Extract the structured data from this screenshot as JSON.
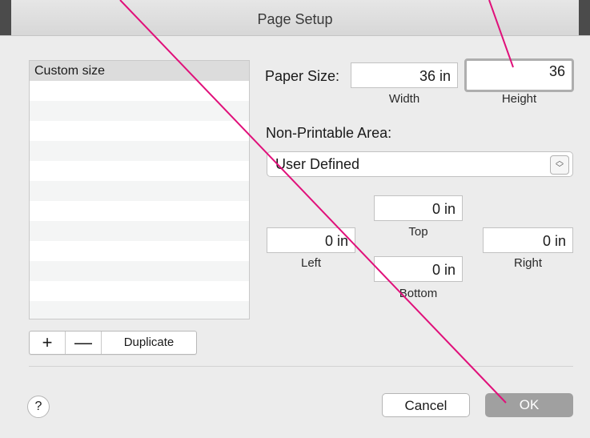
{
  "window": {
    "title": "Page Setup"
  },
  "list": {
    "items": [
      "Custom size"
    ],
    "empty_rows": 12
  },
  "list_buttons": {
    "add": "+",
    "remove": "—",
    "duplicate": "Duplicate"
  },
  "paper_size": {
    "label": "Paper Size:",
    "width_value": "36 in",
    "height_value": "36",
    "width_caption": "Width",
    "height_caption": "Height"
  },
  "non_printable": {
    "label": "Non-Printable Area:",
    "selected": "User Defined",
    "top_value": "0 in",
    "top_label": "Top",
    "left_value": "0 in",
    "left_label": "Left",
    "right_value": "0 in",
    "right_label": "Right",
    "bottom_value": "0 in",
    "bottom_label": "Bottom"
  },
  "footer": {
    "help": "?",
    "cancel": "Cancel",
    "ok": "OK"
  },
  "colors": {
    "annotation_line": "#e0107a",
    "ok_button": "#a0a0a0"
  }
}
